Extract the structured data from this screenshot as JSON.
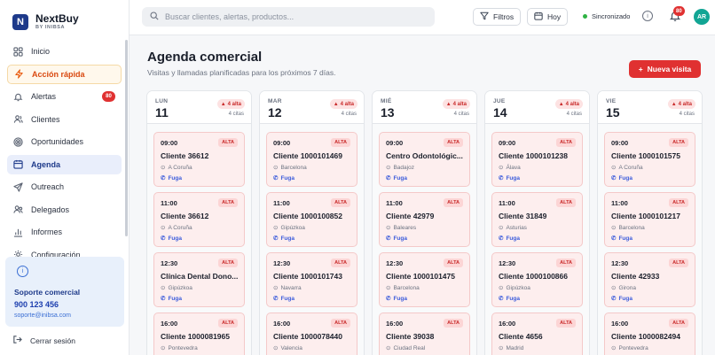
{
  "brand": {
    "logo_letter": "N",
    "name": "NextBuy",
    "subtitle": "BY INIBSA"
  },
  "sidebar": {
    "items": [
      {
        "label": "Inicio",
        "icon": "grid-icon"
      },
      {
        "label": "Acción rápida",
        "icon": "lightning-icon"
      },
      {
        "label": "Alertas",
        "icon": "bell-icon",
        "badge": "80"
      },
      {
        "label": "Clientes",
        "icon": "users-icon"
      },
      {
        "label": "Oportunidades",
        "icon": "target-icon"
      },
      {
        "label": "Agenda",
        "icon": "calendar-icon"
      },
      {
        "label": "Outreach",
        "icon": "send-icon"
      },
      {
        "label": "Delegados",
        "icon": "people-icon"
      },
      {
        "label": "Informes",
        "icon": "bar-chart-icon"
      },
      {
        "label": "Configuración",
        "icon": "gear-icon"
      }
    ],
    "support": {
      "title": "Soporte comercial",
      "phone": "900 123 456",
      "email": "soporte@inibsa.com"
    },
    "logout": "Cerrar sesión"
  },
  "topbar": {
    "search_placeholder": "Buscar clientes, alertas, productos...",
    "filters_label": "Filtros",
    "today_label": "Hoy",
    "sync_label": "Sincronizado",
    "notifications_badge": "80",
    "avatar_initials": "AR"
  },
  "main": {
    "title": "Agenda comercial",
    "subtitle": "Visitas y llamadas planificadas para los próximos 7 días.",
    "new_visit_label": "Nueva visita",
    "days": [
      {
        "dow": "LUN",
        "num": "11",
        "alta": "4 alta",
        "count": "4 citas",
        "cards": [
          {
            "time": "09:00",
            "prio": "ALTA",
            "name": "Cliente 36612",
            "loc": "A Coruña",
            "tag": "Fuga"
          },
          {
            "time": "11:00",
            "prio": "ALTA",
            "name": "Cliente 36612",
            "loc": "A Coruña",
            "tag": "Fuga"
          },
          {
            "time": "12:30",
            "prio": "ALTA",
            "name": "Clínica Dental Dono...",
            "loc": "Gipúzkoa",
            "tag": "Fuga"
          },
          {
            "time": "16:00",
            "prio": "ALTA",
            "name": "Cliente 1000081965",
            "loc": "Pontevedra",
            "tag": ""
          }
        ]
      },
      {
        "dow": "MAR",
        "num": "12",
        "alta": "4 alta",
        "count": "4 citas",
        "cards": [
          {
            "time": "09:00",
            "prio": "ALTA",
            "name": "Cliente 1000101469",
            "loc": "Barcelona",
            "tag": "Fuga"
          },
          {
            "time": "11:00",
            "prio": "ALTA",
            "name": "Cliente 1000100852",
            "loc": "Gipúzkoa",
            "tag": "Fuga"
          },
          {
            "time": "12:30",
            "prio": "ALTA",
            "name": "Cliente 1000101743",
            "loc": "Navarra",
            "tag": "Fuga"
          },
          {
            "time": "16:00",
            "prio": "ALTA",
            "name": "Cliente 1000078440",
            "loc": "Valencia",
            "tag": ""
          }
        ]
      },
      {
        "dow": "MIÉ",
        "num": "13",
        "alta": "4 alta",
        "count": "4 citas",
        "cards": [
          {
            "time": "09:00",
            "prio": "ALTA",
            "name": "Centro Odontológic...",
            "loc": "Badajoz",
            "tag": "Fuga"
          },
          {
            "time": "11:00",
            "prio": "ALTA",
            "name": "Cliente 42979",
            "loc": "Baleares",
            "tag": "Fuga"
          },
          {
            "time": "12:30",
            "prio": "ALTA",
            "name": "Cliente 1000101475",
            "loc": "Barcelona",
            "tag": "Fuga"
          },
          {
            "time": "16:00",
            "prio": "ALTA",
            "name": "Cliente 39038",
            "loc": "Ciudad Real",
            "tag": ""
          }
        ]
      },
      {
        "dow": "JUE",
        "num": "14",
        "alta": "4 alta",
        "count": "4 citas",
        "cards": [
          {
            "time": "09:00",
            "prio": "ALTA",
            "name": "Cliente 1000101238",
            "loc": "Álava",
            "tag": "Fuga"
          },
          {
            "time": "11:00",
            "prio": "ALTA",
            "name": "Cliente 31849",
            "loc": "Asturias",
            "tag": "Fuga"
          },
          {
            "time": "12:30",
            "prio": "ALTA",
            "name": "Cliente 1000100866",
            "loc": "Gipúzkoa",
            "tag": "Fuga"
          },
          {
            "time": "16:00",
            "prio": "ALTA",
            "name": "Cliente 4656",
            "loc": "Madrid",
            "tag": ""
          }
        ]
      },
      {
        "dow": "VIE",
        "num": "15",
        "alta": "4 alta",
        "count": "4 citas",
        "cards": [
          {
            "time": "09:00",
            "prio": "ALTA",
            "name": "Cliente 1000101575",
            "loc": "A Coruña",
            "tag": "Fuga"
          },
          {
            "time": "11:00",
            "prio": "ALTA",
            "name": "Cliente 1000101217",
            "loc": "Barcelona",
            "tag": "Fuga"
          },
          {
            "time": "12:30",
            "prio": "ALTA",
            "name": "Cliente 42933",
            "loc": "Girona",
            "tag": "Fuga"
          },
          {
            "time": "16:00",
            "prio": "ALTA",
            "name": "Cliente 1000082494",
            "loc": "Pontevedra",
            "tag": ""
          }
        ]
      }
    ]
  }
}
